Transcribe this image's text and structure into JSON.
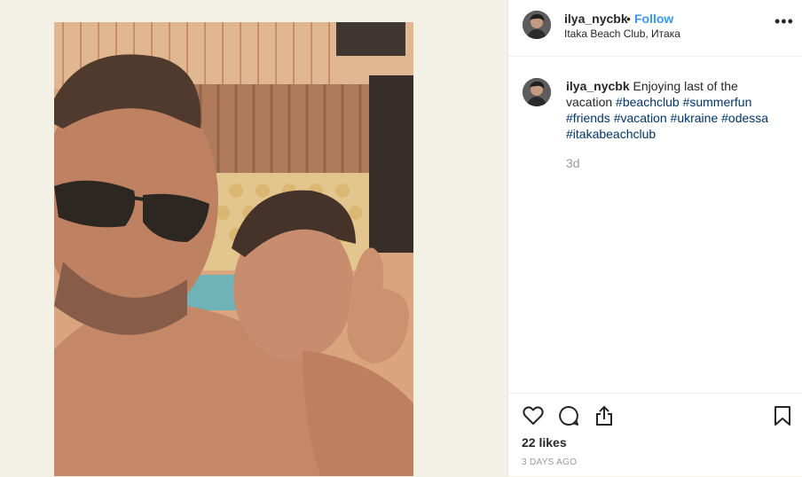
{
  "post": {
    "username": "ilya_nycbk",
    "separator": "•",
    "follow_label": "Follow",
    "location": "Itaka Beach Club, Итака",
    "more_label": "•••"
  },
  "caption": {
    "username": "ilya_nycbk",
    "text": "Enjoying last of the vacation",
    "hashtags": [
      "#beachclub",
      "#summerfun",
      "#friends",
      "#vacation",
      "#ukraine",
      "#odessa",
      "#itakabeachclub"
    ],
    "time_ago": "3d"
  },
  "footer": {
    "likes": "22 likes",
    "date": "3 DAYS AGO"
  },
  "icons": {
    "like": "heart-icon",
    "comment": "comment-icon",
    "share": "share-icon",
    "save": "bookmark-icon",
    "more": "more-icon"
  }
}
